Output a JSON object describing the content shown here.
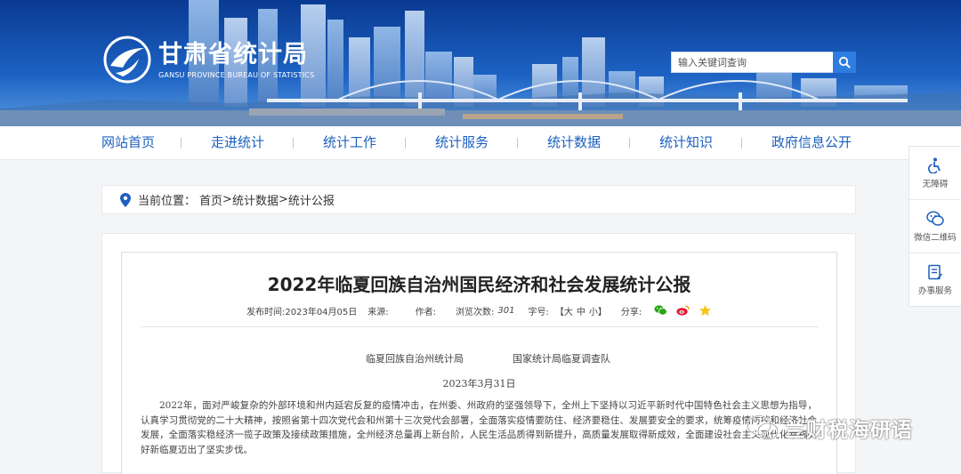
{
  "header": {
    "logo_title": "甘肃省统计局",
    "logo_subtitle": "GANSU PROVINCE BUREAU OF STATISTICS",
    "search_placeholder": "输入关键词查询",
    "search_icon": "search-icon"
  },
  "nav": {
    "items": [
      {
        "label": "网站首页"
      },
      {
        "label": "走进统计"
      },
      {
        "label": "统计工作"
      },
      {
        "label": "统计服务"
      },
      {
        "label": "统计数据"
      },
      {
        "label": "统计知识"
      },
      {
        "label": "政府信息公开"
      }
    ]
  },
  "breadcrumb": {
    "prefix": "当前位置：",
    "items": [
      {
        "label": "首页"
      },
      {
        "label": "统计数据"
      },
      {
        "label": "统计公报"
      }
    ],
    "separator": ">"
  },
  "article": {
    "title": "2022年临夏回族自治州国民经济和社会发展统计公报",
    "meta": {
      "publish_label": "发布时间:",
      "publish_date": "2023年04月05日",
      "source_label": "来源:",
      "author_label": "作者:",
      "views_label": "浏览次数:",
      "views": "301",
      "fontsize_label": "字号:",
      "size_open": "【",
      "size_large": "大",
      "size_medium": "中",
      "size_small": "小",
      "size_close": "】",
      "share_label": "分享:"
    },
    "issuer_left": "临夏回族自治州统计局",
    "issuer_right": "国家统计局临夏调查队",
    "date": "2023年3月31日",
    "paragraph": "2022年，面对严峻复杂的外部环境和州内延宕反复的疫情冲击，在州委、州政府的坚强领导下，全州上下坚持以习近平新时代中国特色社会主义思想为指导，认真学习贯彻党的二十大精神，按照省第十四次党代会和州第十三次党代会部署，全面落实疫情要防住、经济要稳住、发展要安全的要求，统筹疫情防控和经济社会发展，全面落实稳经济一揽子政策及接续政策措施，全州经济总量再上新台阶，人民生活品质得到新提升，高质量发展取得新成效，全面建设社会主义现代化幸福美好新临夏迈出了坚实步伐。"
  },
  "sidebar": {
    "items": [
      {
        "label": "无障碍",
        "icon": "accessibility-icon"
      },
      {
        "label": "微信二维码",
        "icon": "wechat-icon"
      },
      {
        "label": "办事服务",
        "icon": "service-icon"
      }
    ]
  },
  "watermark": {
    "text": "兰财税海研语"
  },
  "colors": {
    "brand_blue": "#1c5fc0",
    "header_dark": "#0b3f98",
    "search_button": "#2e7de1"
  }
}
